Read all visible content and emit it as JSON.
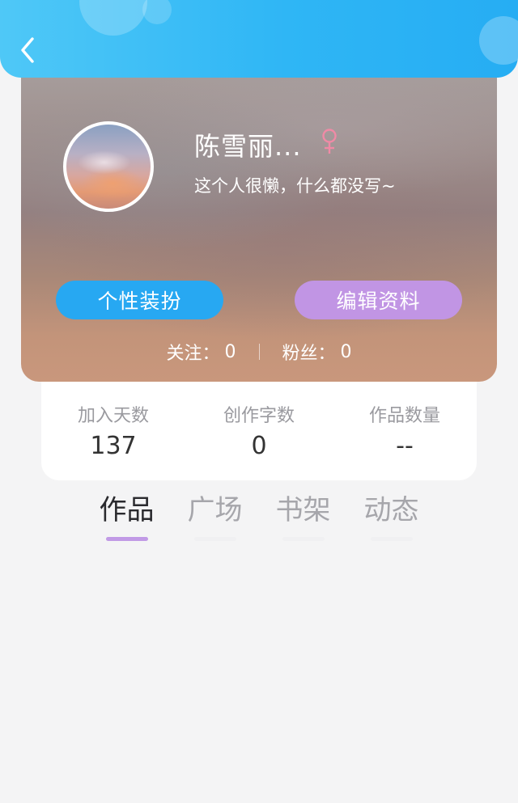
{
  "header": {
    "back_icon": "chevron-left-icon"
  },
  "profile": {
    "username": "陈雪丽...",
    "gender_icon": "female-icon",
    "gender_color": "#f08aa6",
    "bio": "这个人很懒，什么都没写~",
    "dress_button": "个性装扮",
    "edit_button": "编辑资料",
    "following_label": "关注：",
    "following_value": "0",
    "followers_label": "粉丝：",
    "followers_value": "0"
  },
  "stats": [
    {
      "label": "加入天数",
      "value": "137"
    },
    {
      "label": "创作字数",
      "value": "0"
    },
    {
      "label": "作品数量",
      "value": "--"
    }
  ],
  "tabs": [
    {
      "label": "作品",
      "active": true
    },
    {
      "label": "广场",
      "active": false
    },
    {
      "label": "书架",
      "active": false
    },
    {
      "label": "动态",
      "active": false
    }
  ],
  "colors": {
    "header": "#2fb6f5",
    "dress_button": "#27a8f2",
    "edit_button": "#c195e4",
    "tab_indicator": "#c19ae6"
  }
}
